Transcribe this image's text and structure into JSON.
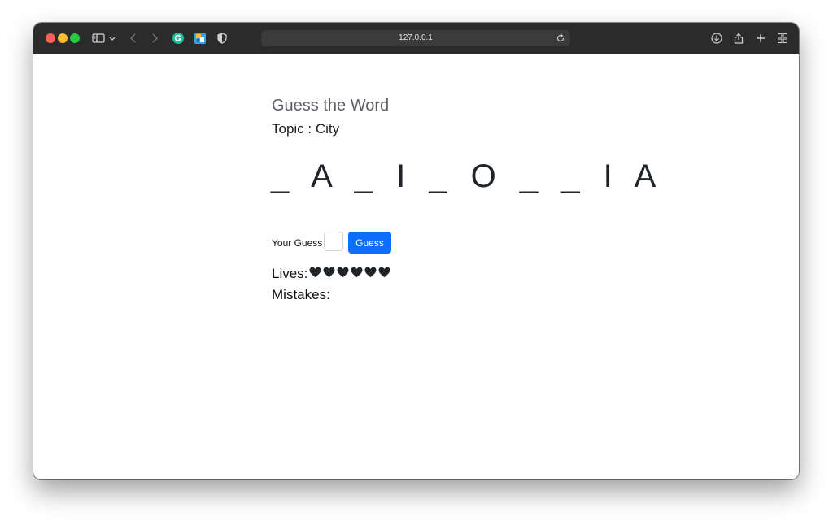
{
  "browser": {
    "url": "127.0.0.1",
    "toolbar_icons": [
      "sidebar-icon",
      "chevron-down-icon",
      "back-icon",
      "forward-icon",
      "grammarly-extension-icon",
      "extension-icon",
      "privacy-shield-icon",
      "reload-icon",
      "download-icon",
      "share-icon",
      "new-tab-icon",
      "tab-overview-icon"
    ]
  },
  "game": {
    "title": "Guess the Word",
    "topic_label": "Topic : City",
    "masked_word": "_ A _ I _ O _ _ I A",
    "guess_label": "Your Guess",
    "guess_value": "",
    "guess_button": "Guess",
    "lives_label": "Lives:",
    "lives_count": 6,
    "mistakes_label": "Mistakes:",
    "mistakes_value": ""
  },
  "colors": {
    "accent": "#0d6efd",
    "title_bar": "#2b2b2b",
    "heart": "#212529"
  }
}
